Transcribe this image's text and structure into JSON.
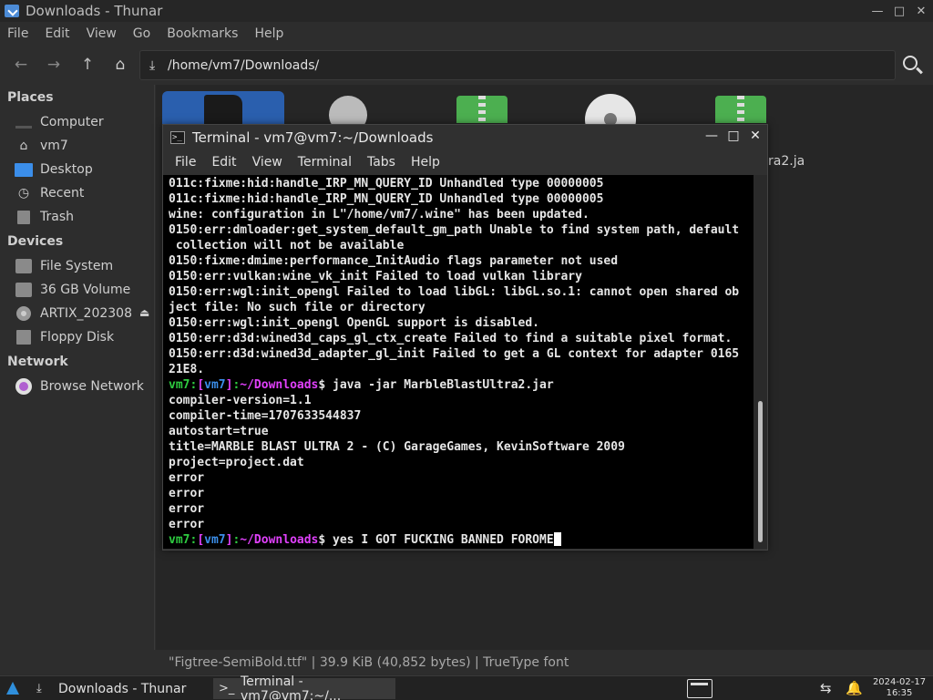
{
  "thunar": {
    "title": "Downloads - Thunar",
    "menu": [
      "File",
      "Edit",
      "View",
      "Go",
      "Bookmarks",
      "Help"
    ],
    "location": "/home/vm7/Downloads/",
    "sidebar": {
      "places_heading": "Places",
      "places": [
        {
          "label": "Computer",
          "icon": "computer-icon"
        },
        {
          "label": "vm7",
          "icon": "home-icon"
        },
        {
          "label": "Desktop",
          "icon": "desktop-icon"
        },
        {
          "label": "Recent",
          "icon": "recent-icon"
        },
        {
          "label": "Trash",
          "icon": "trash-icon"
        }
      ],
      "devices_heading": "Devices",
      "devices": [
        {
          "label": "File System",
          "icon": "drive-icon"
        },
        {
          "label": "36 GB Volume",
          "icon": "drive-icon"
        },
        {
          "label": "ARTIX_202308",
          "icon": "optical-disc-icon"
        },
        {
          "label": "Floppy Disk",
          "icon": "floppy-icon"
        }
      ],
      "network_heading": "Network",
      "network": [
        {
          "label": "Browse Network",
          "icon": "network-icon"
        }
      ]
    },
    "file_partial_label": "ra2.ja",
    "status": "\"Figtree-SemiBold.ttf\"  |  39.9 KiB (40,852 bytes)  |  TrueType font"
  },
  "terminal": {
    "title": "Terminal - vm7@vm7:~/Downloads",
    "menu": [
      "File",
      "Edit",
      "View",
      "Terminal",
      "Tabs",
      "Help"
    ],
    "output_lines": [
      "011c:fixme:hid:handle_IRP_MN_QUERY_ID Unhandled type 00000005",
      "011c:fixme:hid:handle_IRP_MN_QUERY_ID Unhandled type 00000005",
      "wine: configuration in L\"/home/vm7/.wine\" has been updated.",
      "0150:err:dmloader:get_system_default_gm_path Unable to find system path, default",
      " collection will not be available",
      "0150:fixme:dmime:performance_InitAudio flags parameter not used",
      "0150:err:vulkan:wine_vk_init Failed to load vulkan library",
      "0150:err:wgl:init_opengl Failed to load libGL: libGL.so.1: cannot open shared ob",
      "ject file: No such file or directory",
      "0150:err:wgl:init_opengl OpenGL support is disabled.",
      "0150:err:d3d:wined3d_caps_gl_ctx_create Failed to find a suitable pixel format.",
      "0150:err:d3d:wined3d_adapter_gl_init Failed to get a GL context for adapter 0165",
      "21E8."
    ],
    "prompt_user": "vm7",
    "prompt_host": "vm7",
    "prompt_path": "~/Downloads",
    "command1": "java -jar MarbleBlastUltra2.jar",
    "output2_lines": [
      "compiler-version=1.1",
      "compiler-time=1707633544837",
      "autostart=true",
      "title=MARBLE BLAST ULTRA 2 - (C) GarageGames, KevinSoftware 2009",
      "project=project.dat",
      "error",
      "error",
      "error",
      "error"
    ],
    "command2": "yes I GOT FUCKING BANNED FOROME",
    "scrollbar_position": 0.62
  },
  "taskbar": {
    "tasks": [
      {
        "label": "Downloads - Thunar",
        "icon": "download-icon"
      },
      {
        "label": "Terminal - vm7@vm7:~/...",
        "icon": "terminal-icon"
      }
    ],
    "clock_date": "2024-02-17",
    "clock_time": "16:35"
  }
}
